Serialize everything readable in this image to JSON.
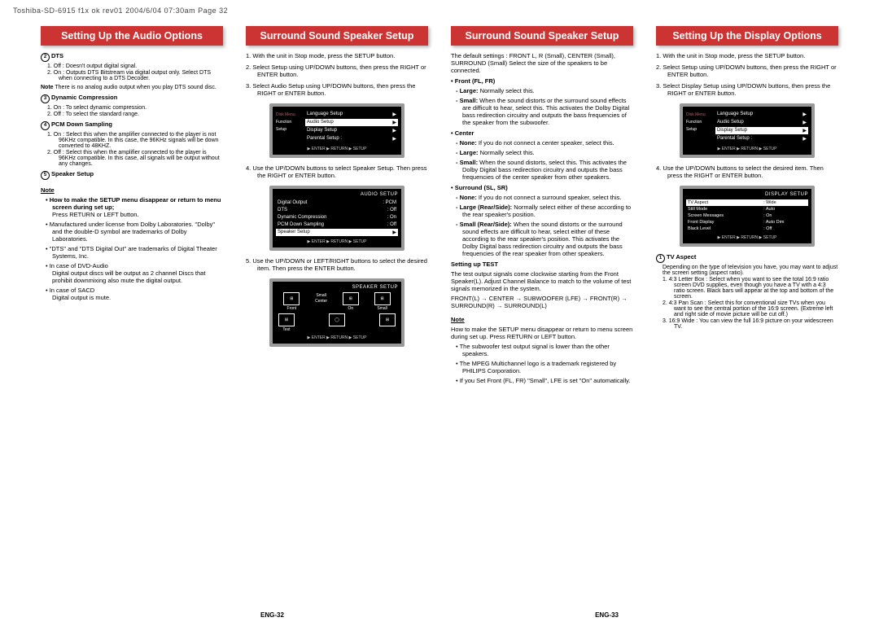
{
  "header": "Toshiba-SD-6915 f1x ok rev01  2004/6/04  07:30am  Page 32",
  "banners": {
    "c1": "Setting Up the Audio Options",
    "c2": "Surround Sound Speaker Setup",
    "c3": "Surround Sound Speaker Setup",
    "c4": "Setting Up the Display Options"
  },
  "col1": {
    "dts_num": "2",
    "dts_head": "DTS",
    "dts_1": "1. Off : Doesn't output digital signal.",
    "dts_2": "2. On : Outputs DTS Bitstream via digital output only. Select DTS when connecting to a DTS Decoder.",
    "dts_note_lbl": "Note",
    "dts_note": "There is no analog audio output when you play DTS sound disc.",
    "dc_num": "3",
    "dc_head": "Dynamic Compression",
    "dc_1": "1. On : To select dynamic compression.",
    "dc_2": "2. Off : To select the standard range.",
    "pcm_num": "4",
    "pcm_head": "PCM Down Sampling",
    "pcm_1": "1. On : Select this when the amplifier connected to the player is not 96KHz compatible. In this case, the 96KHz signals will be down converted to 48KHZ.",
    "pcm_2": "2. Off : Select this when the amplifier connected to the player is 96KHz compatible. In this case, all signals will be output without any changes.",
    "ss_num": "5",
    "ss_head": "Speaker Setup",
    "note_head": "Note",
    "note_b1a": "• How to make the SETUP menu disappear or return to menu screen during set up;",
    "note_b1b": "Press RETURN or LEFT button.",
    "note_b2": "• Manufactured under license from Dolby Laboratories. \"Dolby\" and the double-D symbol are trademarks of Dolby Laboratories.",
    "note_b3": "• \"DTS\" and \"DTS Digital Out\" are trademarks of Digital Theater Systems, Inc.",
    "note_b4a": "• In case of DVD-Audio",
    "note_b4b": "Digital output discs will be output as 2 channel Discs that prohibit downmixing also mute the digital output.",
    "note_b5a": "• In case of SACD",
    "note_b5b": "Digital output is mute."
  },
  "col2": {
    "s1": "1. With the unit in Stop mode, press the SETUP button.",
    "s2": "2. Select Setup using UP/DOWN buttons, then press the RIGHT or ENTER button.",
    "s3": "3. Select Audio Setup using UP/DOWN buttons, then press the RIGHT or ENTER button.",
    "s4": "4. Use the UP/DOWN buttons to select Speaker Setup. Then press the RIGHT or ENTER button.",
    "s5": "5. Use the UP/DOWN or LEFT/RIGHT buttons to select the desired item. Then press the ENTER button.",
    "screen1": {
      "side": {
        "a": "Disk Menu",
        "b": "Function",
        "c": "Setup"
      },
      "r1": {
        "l": "Language Setup",
        "r": "▶"
      },
      "r2": {
        "l": "Audio Setup",
        "r": "▶"
      },
      "r3": {
        "l": "Display Setup",
        "r": "▶"
      },
      "r4": {
        "l": "Parental Setup :",
        "r": "▶"
      },
      "foot": "▶ ENTER    ▶ RETURN    ▶ SETUP"
    },
    "screen2": {
      "title": "AUDIO SETUP",
      "r1": {
        "l": "Digital Output",
        "r": ": PCM"
      },
      "r2": {
        "l": "DTS",
        "r": ": Off"
      },
      "r3": {
        "l": "Dynamic Compression",
        "r": ": On"
      },
      "r4": {
        "l": "PCM Down Sampling",
        "r": ": Off"
      },
      "r5": {
        "l": "Speaker Setup",
        "r": "▶"
      },
      "foot": "▶ ENTER    ▶ RETURN    ▶ SETUP"
    },
    "screen3": {
      "title": "SPEAKER SETUP",
      "front": "Front",
      "center": "Center",
      "small": "Small",
      "on": "On",
      "test": "Test",
      "foot": "▶ ENTER    ▶ RETURN    ▶ SETUP"
    }
  },
  "col3": {
    "intro": "The default settings : FRONT L, R (Small), CENTER (Small), SURROUND (Small) Select the size of the speakers to be connected.",
    "f_head": "• Front (FL, FR)",
    "f_large_l": "- Large:",
    "f_large": " Normally select this.",
    "f_small_l": "- Small:",
    "f_small": " When the sound distorts or the surround sound effects are difficult to hear, select this. This activates the Dolby Digital bass redirection circuitry and outputs the bass frequencies of the speaker from the subwoofer.",
    "c_head": "• Center",
    "c_none_l": "- None:",
    "c_none": " If you do not connect a center speaker, select this.",
    "c_large_l": "- Large:",
    "c_large": " Normally select this.",
    "c_small_l": "- Small:",
    "c_small": " When the sound distorts, select this. This activates the Dolby Digital bass redirection circuitry and outputs the bass frequencies of the center speaker from other speakers.",
    "s_head": "• Surround (SL, SR)",
    "s_none_l": "- None:",
    "s_none": " If you do not connect a surround speaker, select this.",
    "s_large_l": "- Large (Rear/Side):",
    "s_large": " Normally select either of these according to the rear speaker's position.",
    "s_small_l": "- Small (Rear/Side):",
    "s_small": " When the sound distorts or the surround sound effects are difficult to hear, select either of these according to the rear speaker's position. This activates the Dolby Digital bass redirection circuitry and outputs the bass frequencies of the rear speaker from other speakers.",
    "test_head": "Setting up TEST",
    "test_body": "The test output signals come clockwise starting from the Front Speaker(L). Adjust Channel Balance to match to the volume of test signals memorized in the system.",
    "test_chain": "FRONT(L) → CENTER → SUBWOOFER (LFE) → FRONT(R) → SURROUND(R) → SURROUND(L)",
    "note_head": "Note",
    "n1": "How to make the SETUP menu disappear or return to menu screen during set up. Press RETURN or LEFT button.",
    "n2": "• The subwoofer test output signal is lower than the other speakers.",
    "n3": "• The MPEG Multichannel logo is a trademark registered by PHILIPS Corporation.",
    "n4": "• If you Set Front (FL, FR) \"Small\", LFE is set \"On\" automatically."
  },
  "col4": {
    "s1": "1. With the unit in Stop mode, press the SETUP button.",
    "s2": "2. Select Setup using UP/DOWN buttons, then press the RIGHT or ENTER button.",
    "s3": "3. Select Display Setup using UP/DOWN buttons, then press the RIGHT or ENTER button.",
    "s4": "4. Use the UP/DOWN buttons to select the desired item. Then press the RIGHT or ENTER button.",
    "screen1": {
      "side": {
        "a": "Disk Menu",
        "b": "Function",
        "c": "Setup"
      },
      "r1": {
        "l": "Language Setup",
        "r": "▶"
      },
      "r2": {
        "l": "Audio Setup",
        "r": "▶"
      },
      "r3": {
        "l": "Display Setup",
        "r": "▶"
      },
      "r4": {
        "l": "Parental Setup :",
        "r": "▶"
      },
      "foot": "▶ ENTER    ▶ RETURN    ▶ SETUP"
    },
    "screen2": {
      "title": "DISPLAY SETUP",
      "r1": {
        "l": "TV Aspect",
        "r": ": Wide"
      },
      "r2": {
        "l": "Still Mode",
        "r": ": Auto"
      },
      "r3": {
        "l": "Screen Messages",
        "r": ": On"
      },
      "r4": {
        "l": "Front Display",
        "r": ": Auto Dim"
      },
      "r5": {
        "l": "Black Level",
        "r": ": Off"
      },
      "foot": "▶ ENTER    ▶ RETURN    ▶ SETUP"
    },
    "tv_num": "1",
    "tv_head": "TV Aspect",
    "tv_intro": "Depending on the type of television you have, you may want to adjust the screen setting (aspect ratio).",
    "tv_1": "1. 4:3 Letter Box : Select when you want to see the total 16:9 ratio screen DVD supplies, even though you have a TV with a 4:3 ratio screen. Black bars will appear at the top and bottom of the screen.",
    "tv_2": "2. 4:3 Pan Scan : Select this for conventional size TVs when you want to see the central portion of the 16:9 screen. (Extreme left and right side of movie picture will be cut off.)",
    "tv_3": "3. 16:9 Wide : You can view the full 16:9 picture on your widescreen TV."
  },
  "footer": {
    "left": "ENG-32",
    "right": "ENG-33"
  }
}
